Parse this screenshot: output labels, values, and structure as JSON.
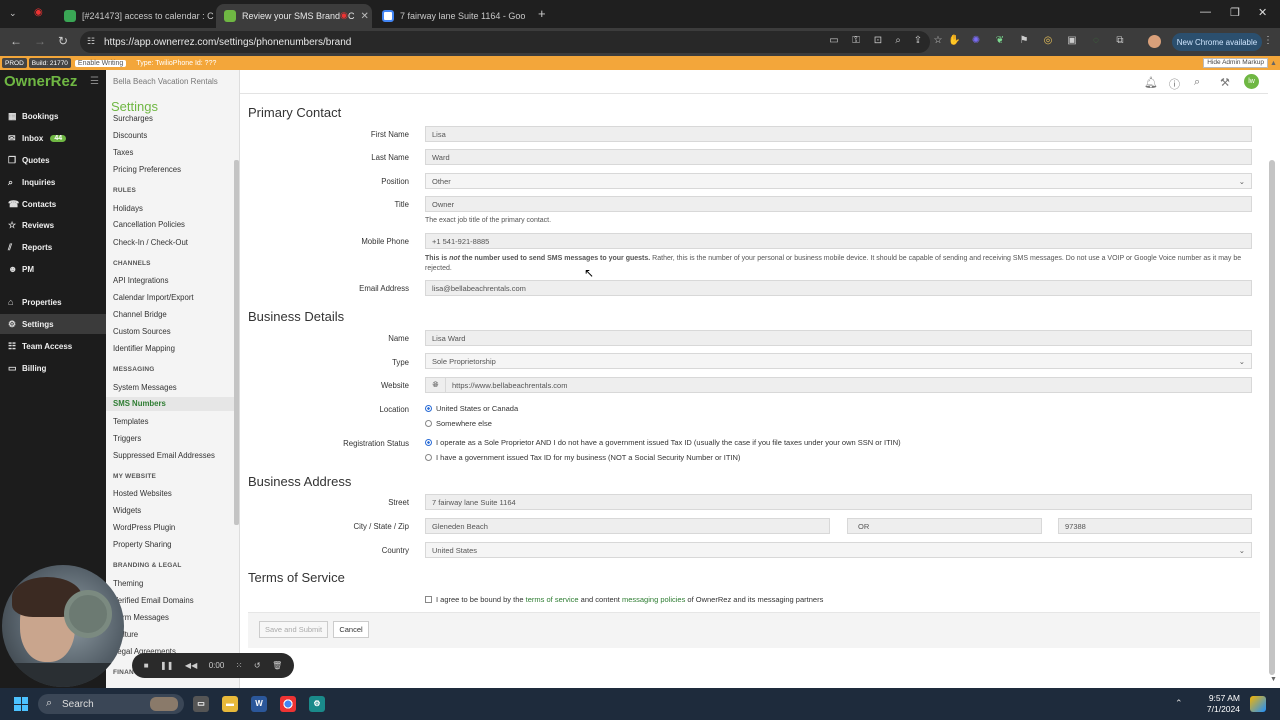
{
  "browser": {
    "tabs": [
      {
        "title": "[#241473] access to calendar : C",
        "favicon": "helpdesk-icon"
      },
      {
        "title": "Review your SMS Brand - C",
        "favicon": "ownerrez-icon"
      },
      {
        "title": "7 fairway lane Suite 1164 - Goo",
        "favicon": "google-icon"
      }
    ],
    "url": "https://app.ownerrez.com/settings/phonenumbers/brand",
    "new_chrome_label": "New Chrome available"
  },
  "adminbar": {
    "env": "PROD",
    "build": "Build: 21770",
    "enable_writing": "Enable Writing",
    "type_info": "Type: TwilioPhone Id: ???",
    "hide_markup": "Hide Admin Markup"
  },
  "app": {
    "logo": "OwnerRez",
    "business_name": "Bella Beach Vacation Rentals",
    "user_initials": "lw"
  },
  "nav": {
    "items": [
      {
        "label": "Bookings",
        "icon": "calendar-icon"
      },
      {
        "label": "Inbox",
        "icon": "inbox-icon",
        "badge": "44"
      },
      {
        "label": "Quotes",
        "icon": "quote-icon"
      },
      {
        "label": "Inquiries",
        "icon": "inquiry-icon"
      },
      {
        "label": "Contacts",
        "icon": "contacts-icon"
      },
      {
        "label": "Reviews",
        "icon": "star-icon"
      },
      {
        "label": "Reports",
        "icon": "chart-icon"
      },
      {
        "label": "PM",
        "icon": "pm-icon"
      },
      {
        "label": "Properties",
        "icon": "home-icon"
      },
      {
        "label": "Settings",
        "icon": "gear-icon"
      },
      {
        "label": "Team Access",
        "icon": "team-icon"
      },
      {
        "label": "Billing",
        "icon": "billing-icon"
      }
    ]
  },
  "settings": {
    "title": "Settings",
    "items": [
      "Surcharges",
      "Discounts",
      "Taxes",
      "Pricing Preferences",
      "RULES",
      "Holidays",
      "Cancellation Policies",
      "Check-In / Check-Out",
      "CHANNELS",
      "API Integrations",
      "Calendar Import/Export",
      "Channel Bridge",
      "Custom Sources",
      "Identifier Mapping",
      "MESSAGING",
      "System Messages",
      "SMS Numbers",
      "Templates",
      "Triggers",
      "Suppressed Email Addresses",
      "MY WEBSITE",
      "Hosted Websites",
      "Widgets",
      "WordPress Plugin",
      "Property Sharing",
      "BRANDING & LEGAL",
      "Theming",
      "Verified Email Domains",
      "Form Messages",
      "Culture",
      "Legal Agreements",
      "FINANCIAL"
    ]
  },
  "primary_contact": {
    "title": "Primary Contact",
    "first_name_label": "First Name",
    "first_name": "Lisa",
    "last_name_label": "Last Name",
    "last_name": "Ward",
    "position_label": "Position",
    "position": "Other",
    "title_label": "Title",
    "title_value": "Owner",
    "title_help": "The exact job title of the primary contact.",
    "mobile_label": "Mobile Phone",
    "mobile": "+1 541-921-8885",
    "mobile_help_1": "This is ",
    "mobile_help_2": "not",
    "mobile_help_3": " the number used to send SMS messages to your guests.",
    "mobile_help_4": " Rather, this is the number of your personal or business mobile device. It should be capable of sending and receiving SMS messages. Do not use a VOIP or Google Voice number as it may be rejected.",
    "email_label": "Email Address",
    "email": "lisa@bellabeachrentals.com"
  },
  "business": {
    "title": "Business Details",
    "name_label": "Name",
    "name": "Lisa Ward",
    "type_label": "Type",
    "type": "Sole Proprietorship",
    "website_label": "Website",
    "website": "https://www.bellabeachrentals.com",
    "location_label": "Location",
    "location_options": [
      "United States or Canada",
      "Somewhere else"
    ],
    "reg_label": "Registration Status",
    "reg_options": [
      "I operate as a Sole Proprietor AND I do not have a government issued Tax ID (usually the case if you file taxes under your own SSN or ITIN)",
      "I have a government issued Tax ID for my business (NOT a Social Security Number or ITIN)"
    ]
  },
  "address": {
    "title": "Business Address",
    "street_label": "Street",
    "street": "7 fairway lane Suite 1164",
    "csz_label": "City / State / Zip",
    "city": "Gleneden Beach",
    "state": "OR",
    "zip": "97388",
    "country_label": "Country",
    "country": "United States"
  },
  "tos": {
    "title": "Terms of Service",
    "text_1": "I agree to be bound by the ",
    "link_1": "terms of service",
    "text_2": " and content ",
    "link_2": "messaging policies",
    "text_3": " of OwnerRez and its messaging partners"
  },
  "actions": {
    "save": "Save and Submit",
    "cancel": "Cancel"
  },
  "recorder": {
    "time": "0:00"
  },
  "taskbar": {
    "search": "Search",
    "time": "9:57 AM",
    "date": "7/1/2024"
  }
}
